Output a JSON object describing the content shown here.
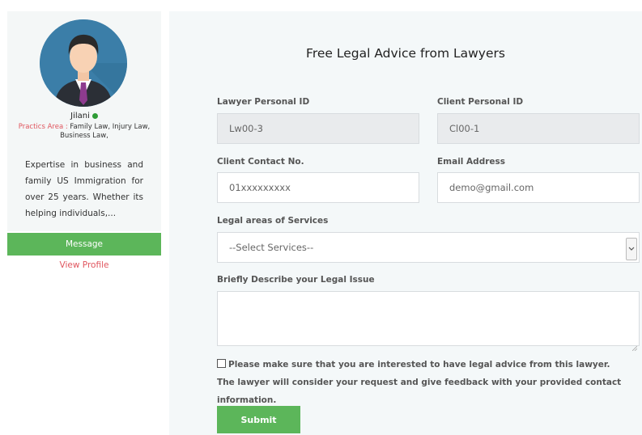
{
  "profile": {
    "name": "Jilani",
    "online_color": "#2e9c36",
    "practice_label": "Practics Area : ",
    "practice_areas": "Family Law, Injury Law, Business Law,",
    "bio": "Expertise in business and family US Immigration for over 25 years. Whether its helping individuals,...",
    "message_label": "Message",
    "view_profile_label": "View Profile"
  },
  "form": {
    "title": "Free Legal Advice from Lawyers",
    "lawyer_id": {
      "label": "Lawyer Personal ID",
      "value": "Lw00-3"
    },
    "client_id": {
      "label": "Client Personal ID",
      "value": "Cl00-1"
    },
    "contact": {
      "label": "Client Contact No.",
      "value": "01xxxxxxxxx"
    },
    "email": {
      "label": "Email Address",
      "value": "demo@gmail.com"
    },
    "services": {
      "label": "Legal areas of Services",
      "selected": "--Select Services--"
    },
    "issue": {
      "label": "Briefly Describe your Legal Issue",
      "value": ""
    },
    "agreement": "Please make sure that you are interested to have legal advice from this lawyer. The lawyer will consider your request and give feedback with your provided contact information.",
    "submit_label": "Submit"
  },
  "colors": {
    "accent_green": "#5cb65a",
    "link_red": "#e0555e",
    "panel_bg": "#f4f8f9"
  }
}
